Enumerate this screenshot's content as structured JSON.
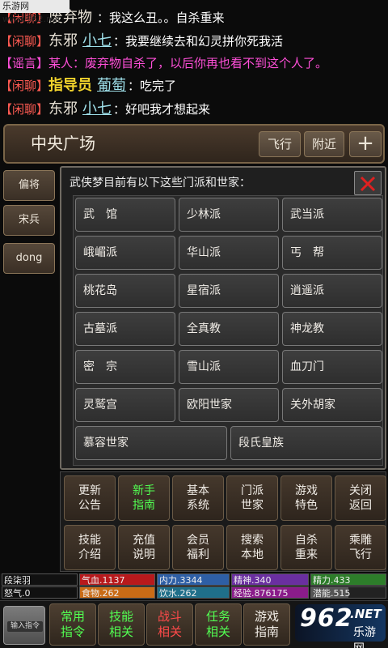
{
  "watermark": "乐游网 www.962.net",
  "chat": [
    {
      "channel": "【闲聊】",
      "speaker": "废弃物",
      "target": "",
      "message": "：我这么丑。。自杀重来",
      "rumor": false,
      "gold": false
    },
    {
      "channel": "【闲聊】",
      "speaker": "东邪",
      "target": "小七",
      "message": "：我要继续去和幻灵拼你死我活",
      "rumor": false,
      "gold": false
    },
    {
      "channel": "【谣言】",
      "speaker": "",
      "target": "",
      "message": "某人：废弃物自杀了，以后你再也看不到这个人了。",
      "rumor": true,
      "gold": false
    },
    {
      "channel": "【闲聊】",
      "speaker": "指导员",
      "target": "葡萄",
      "message": "：吃完了",
      "rumor": false,
      "gold": true
    },
    {
      "channel": "【闲聊】",
      "speaker": "东邪",
      "target": "小七",
      "message": "：好吧我才想起来",
      "rumor": false,
      "gold": false
    }
  ],
  "location": {
    "name": "中央广场",
    "fly_label": "飞行",
    "nearby_label": "附近",
    "plus_label": "+"
  },
  "players": [
    "偏将",
    "宋兵",
    "dong"
  ],
  "sect_panel": {
    "title": "武侠梦目前有以下这些门派和世家：",
    "sects": [
      "武　馆",
      "少林派",
      "武当派",
      "峨嵋派",
      "华山派",
      "丐　帮",
      "桃花岛",
      "星宿派",
      "逍遥派",
      "古墓派",
      "全真教",
      "神龙教",
      "密　宗",
      "雪山派",
      "血刀门",
      "灵鹫宫",
      "欧阳世家",
      "关外胡家",
      "慕容世家",
      "段氏皇族"
    ]
  },
  "menu": [
    {
      "line1": "更新",
      "line2": "公告",
      "green": false
    },
    {
      "line1": "新手",
      "line2": "指南",
      "green": true
    },
    {
      "line1": "基本",
      "line2": "系统",
      "green": false
    },
    {
      "line1": "门派",
      "line2": "世家",
      "green": false
    },
    {
      "line1": "游戏",
      "line2": "特色",
      "green": false
    },
    {
      "line1": "关闭",
      "line2": "返回",
      "green": false
    },
    {
      "line1": "技能",
      "line2": "介绍",
      "green": false
    },
    {
      "line1": "充值",
      "line2": "说明",
      "green": false
    },
    {
      "line1": "会员",
      "line2": "福利",
      "green": false
    },
    {
      "line1": "搜索",
      "line2": "本地",
      "green": false
    },
    {
      "line1": "自杀",
      "line2": "重来",
      "green": false
    },
    {
      "line1": "乘雕",
      "line2": "飞行",
      "green": false
    }
  ],
  "stats": {
    "player_name": "段柒羽",
    "qixue": "气血.1137",
    "neili": "内力.3344",
    "jingshen": "精神.340",
    "jingli": "精力.433",
    "nuqi": "怒气.0",
    "shiwu": "食物.262",
    "yinshui": "饮水.262",
    "jingyan": "经验.876175",
    "qianneng": "潜能.515",
    "bar_colors": {
      "qixue": "#b8191c",
      "neili": "#2e5fa6",
      "jingshen": "#6a2fa0",
      "jingli": "#2d7d2a",
      "shiwu": "#c96b16",
      "yinshui": "#1f6f8a",
      "jingyan": "#8a1c8a",
      "qianneng": "#555555"
    },
    "bar_levels": {
      "qixue": 1.0,
      "neili": 1.0,
      "jingshen": 1.0,
      "jingli": 1.0,
      "shiwu": 1.0,
      "yinshui": 1.0,
      "jingyan": 1.0,
      "qianneng": 0.5
    }
  },
  "tabbar": {
    "input_label": "输入指令",
    "tabs": [
      {
        "line1": "常用",
        "line2": "指令",
        "color": "green"
      },
      {
        "line1": "技能",
        "line2": "相关",
        "color": "green"
      },
      {
        "line1": "战斗",
        "line2": "相关",
        "color": "red"
      },
      {
        "line1": "任务",
        "line2": "相关",
        "color": "green"
      },
      {
        "line1": "游戏",
        "line2": "指南",
        "color": "white"
      }
    ]
  },
  "logo": {
    "brand": "962",
    "suffix": ".NET",
    "sub": "乐游网"
  }
}
